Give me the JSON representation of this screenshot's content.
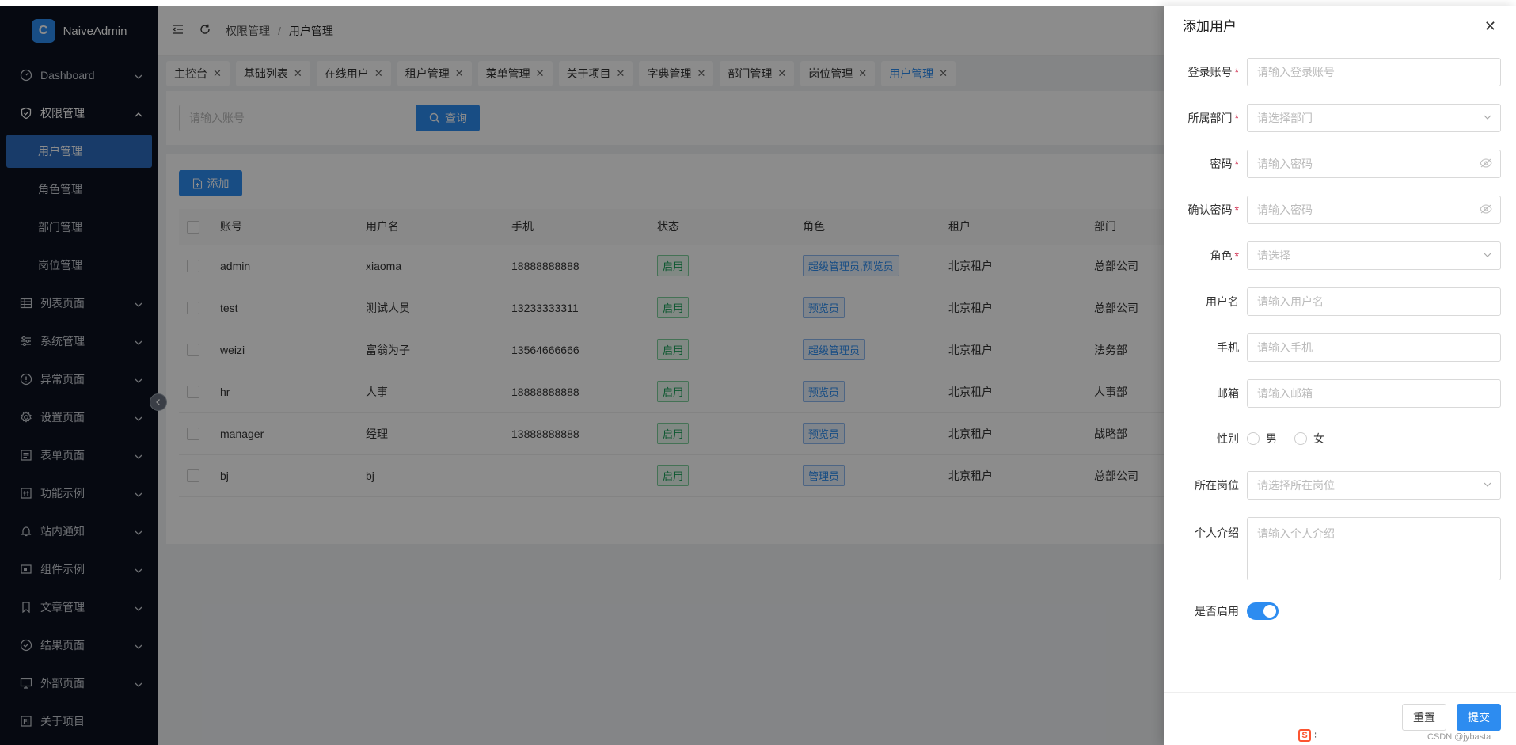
{
  "app": {
    "name": "NaiveAdmin",
    "logo_letter": "C"
  },
  "sidebar": {
    "items": [
      {
        "label": "Dashboard",
        "icon": "dashboard-icon"
      },
      {
        "label": "权限管理",
        "icon": "shield-icon",
        "open": true,
        "children": [
          {
            "label": "用户管理",
            "active": true
          },
          {
            "label": "角色管理"
          },
          {
            "label": "部门管理"
          },
          {
            "label": "岗位管理"
          }
        ]
      },
      {
        "label": "列表页面",
        "icon": "table-icon"
      },
      {
        "label": "系统管理",
        "icon": "sliders-icon"
      },
      {
        "label": "异常页面",
        "icon": "alert-icon"
      },
      {
        "label": "设置页面",
        "icon": "gear-icon"
      },
      {
        "label": "表单页面",
        "icon": "form-icon"
      },
      {
        "label": "功能示例",
        "icon": "function-icon"
      },
      {
        "label": "站内通知",
        "icon": "bell-icon"
      },
      {
        "label": "组件示例",
        "icon": "component-icon"
      },
      {
        "label": "文章管理",
        "icon": "bookmark-icon"
      },
      {
        "label": "结果页面",
        "icon": "check-circle-icon"
      },
      {
        "label": "外部页面",
        "icon": "monitor-icon"
      },
      {
        "label": "关于项目",
        "icon": "about-icon"
      }
    ]
  },
  "header": {
    "breadcrumb": [
      "权限管理",
      "用户管理"
    ],
    "breadcrumb_sep": "/"
  },
  "tabs": [
    {
      "label": "主控台"
    },
    {
      "label": "基础列表"
    },
    {
      "label": "在线用户"
    },
    {
      "label": "租户管理"
    },
    {
      "label": "菜单管理"
    },
    {
      "label": "关于项目"
    },
    {
      "label": "字典管理"
    },
    {
      "label": "部门管理"
    },
    {
      "label": "岗位管理"
    },
    {
      "label": "用户管理",
      "active": true
    }
  ],
  "search": {
    "placeholder": "请输入账号",
    "button": "查询"
  },
  "toolbar": {
    "add_label": "添加"
  },
  "table": {
    "columns": [
      "账号",
      "用户名",
      "手机",
      "状态",
      "角色",
      "租户",
      "部门"
    ],
    "rows": [
      {
        "account": "admin",
        "username": "xiaoma",
        "phone": "18888888888",
        "status": "启用",
        "role": "超级管理员,预览员",
        "tenant": "北京租户",
        "dept": "总部公司"
      },
      {
        "account": "test",
        "username": "测试人员",
        "phone": "13233333311",
        "status": "启用",
        "role": "预览员",
        "tenant": "北京租户",
        "dept": "总部公司"
      },
      {
        "account": "weizi",
        "username": "富翁为子",
        "phone": "13564666666",
        "status": "启用",
        "role": "超级管理员",
        "tenant": "北京租户",
        "dept": "法务部"
      },
      {
        "account": "hr",
        "username": "人事",
        "phone": "18888888888",
        "status": "启用",
        "role": "预览员",
        "tenant": "北京租户",
        "dept": "人事部"
      },
      {
        "account": "manager",
        "username": "经理",
        "phone": "13888888888",
        "status": "启用",
        "role": "预览员",
        "tenant": "北京租户",
        "dept": "战略部"
      },
      {
        "account": "bj",
        "username": "bj",
        "phone": "",
        "status": "启用",
        "role": "管理员",
        "tenant": "北京租户",
        "dept": "总部公司"
      }
    ]
  },
  "drawer": {
    "title": "添加用户",
    "fields": {
      "login": {
        "label": "登录账号",
        "required": true,
        "placeholder": "请输入登录账号"
      },
      "dept": {
        "label": "所属部门",
        "required": true,
        "placeholder": "请选择部门"
      },
      "password": {
        "label": "密码",
        "required": true,
        "placeholder": "请输入密码"
      },
      "confirm": {
        "label": "确认密码",
        "required": true,
        "placeholder": "请输入密码"
      },
      "role": {
        "label": "角色",
        "required": true,
        "placeholder": "请选择"
      },
      "username": {
        "label": "用户名",
        "placeholder": "请输入用户名"
      },
      "phone": {
        "label": "手机",
        "placeholder": "请输入手机"
      },
      "email": {
        "label": "邮箱",
        "placeholder": "请输入邮箱"
      },
      "gender": {
        "label": "性别",
        "options": [
          "男",
          "女"
        ]
      },
      "post": {
        "label": "所在岗位",
        "placeholder": "请选择所在岗位"
      },
      "intro": {
        "label": "个人介绍",
        "placeholder": "请输入个人介绍"
      },
      "enabled": {
        "label": "是否启用",
        "value": true
      }
    },
    "reset": "重置",
    "submit": "提交",
    "required_mark": "*"
  },
  "watermark": "CSDN @jybasta",
  "colors": {
    "primary": "#2d8cf0",
    "sidebar_bg": "#0b1220",
    "success": "#18a058",
    "required": "#d03050"
  }
}
